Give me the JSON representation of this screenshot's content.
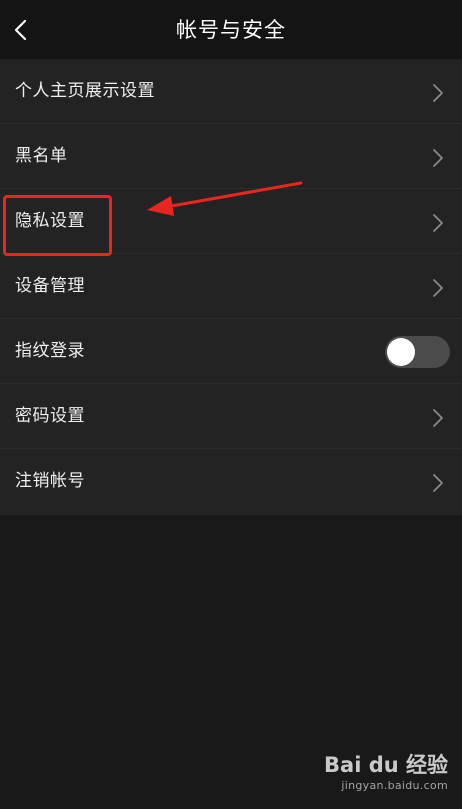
{
  "header": {
    "title": "帐号与安全",
    "back_icon": "chevron-left-icon"
  },
  "settings": [
    {
      "label": "个人主页展示设置",
      "control": "chevron"
    },
    {
      "label": "黑名单",
      "control": "chevron"
    },
    {
      "label": "隐私设置",
      "control": "chevron"
    },
    {
      "label": "设备管理",
      "control": "chevron"
    },
    {
      "label": "指纹登录",
      "control": "toggle",
      "toggle_on": false
    },
    {
      "label": "密码设置",
      "control": "chevron"
    },
    {
      "label": "注销帐号",
      "control": "chevron"
    }
  ],
  "annotation": {
    "color": "#e8261f"
  },
  "watermark": {
    "brand_text": "Bai du 经验",
    "url": "jingyan.baidu.com"
  },
  "colors": {
    "background": "#191919",
    "row_background": "#232323",
    "header_background": "#141414",
    "text": "#efefef",
    "toggle_track": "#4b4b4b"
  }
}
